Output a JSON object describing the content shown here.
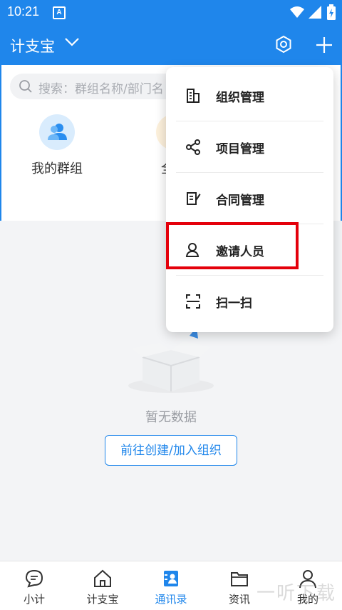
{
  "status_bar": {
    "time": "10:21",
    "badge": "A"
  },
  "app_bar": {
    "title": "计支宝"
  },
  "search": {
    "placeholder": "搜索：群组名称/部门名"
  },
  "entries": [
    {
      "label": "我的群组",
      "color": "#2a8ef0"
    },
    {
      "label": "全部",
      "color": "#f5a623"
    }
  ],
  "empty": {
    "text": "暂无数据",
    "cta": "前往创建/加入组织"
  },
  "menu": {
    "items": [
      {
        "label": "组织管理",
        "icon": "building-icon"
      },
      {
        "label": "项目管理",
        "icon": "share-icon"
      },
      {
        "label": "合同管理",
        "icon": "contract-icon"
      },
      {
        "label": "邀请人员",
        "icon": "person-icon"
      },
      {
        "label": "扫一扫",
        "icon": "scan-icon"
      }
    ]
  },
  "tabs": [
    {
      "label": "小计",
      "icon": "chat-icon"
    },
    {
      "label": "计支宝",
      "icon": "home-icon"
    },
    {
      "label": "通讯录",
      "icon": "contacts-icon",
      "active": true
    },
    {
      "label": "资讯",
      "icon": "folder-icon"
    },
    {
      "label": "我的",
      "icon": "user-icon"
    }
  ],
  "watermark": "一听下载",
  "colors": {
    "primary": "#1f86eb",
    "highlight": "#e4000b"
  }
}
